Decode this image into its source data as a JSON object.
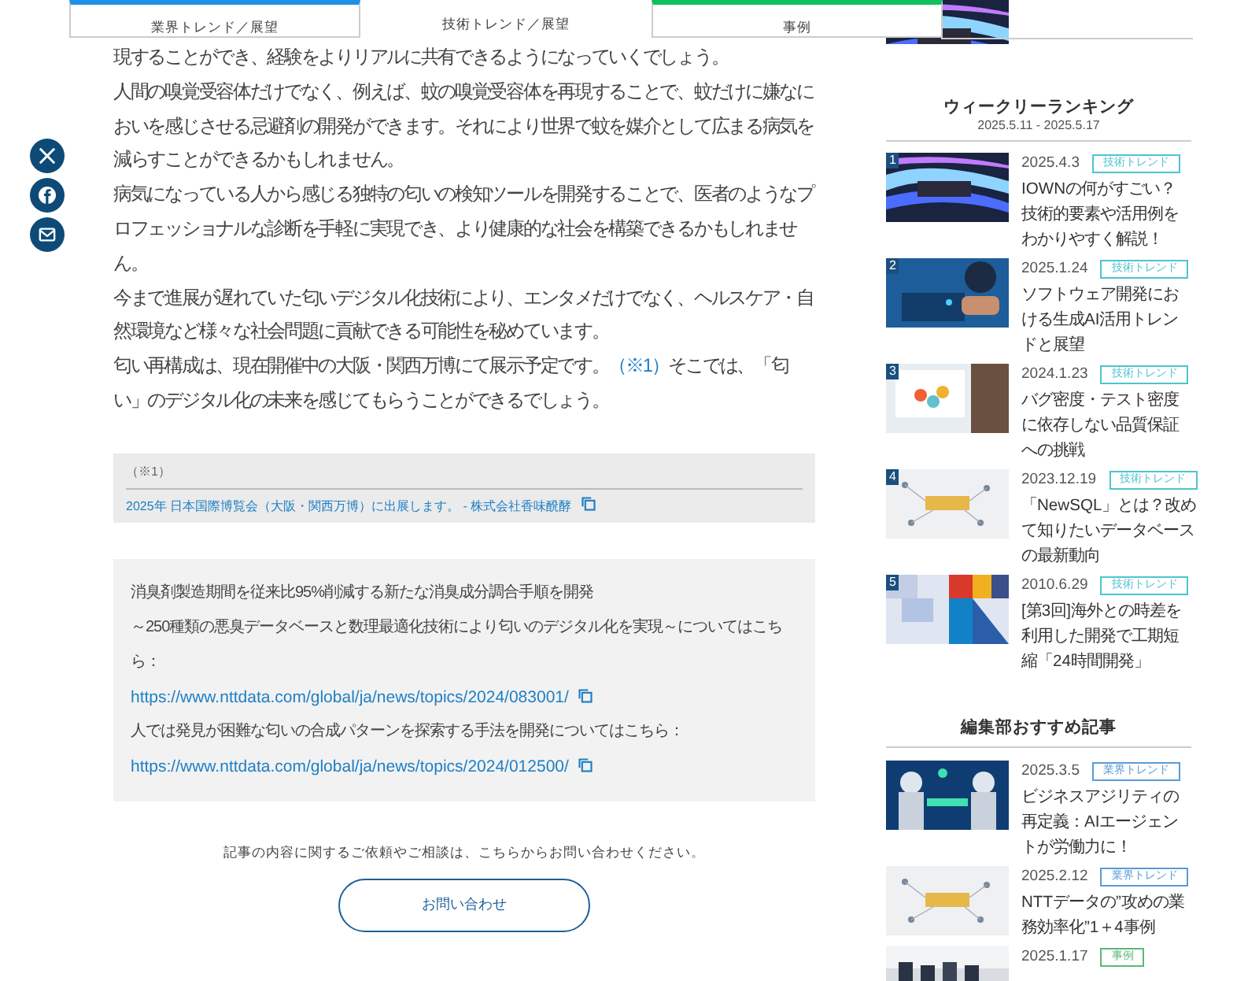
{
  "tabs": [
    {
      "label": "業界トレンド／展望",
      "selected": false,
      "color": "#1e90e6"
    },
    {
      "label": "技術トレンド／展望",
      "selected": true
    },
    {
      "label": "事例",
      "selected": false,
      "color": "#10c060"
    }
  ],
  "share": [
    {
      "kind": "x"
    },
    {
      "kind": "facebook"
    },
    {
      "kind": "mail"
    }
  ],
  "article": {
    "paragraphs": [
      "現することができ、経験をよりリアルに共有できるようになっていくでしょう。",
      "人間の嗅覚受容体だけでなく、例えば、蚊の嗅覚受容体を再現することで、蚊だけに嫌なにおいを感じさせる忌避剤の開発ができます。それにより世界で蚊を媒介として広まる病気を減らすことができるかもしれません。",
      "病気になっている人から感じる独特の匂いの検知ツールを開発することで、医者のようなプロフェッショナルな診断を手軽に実現でき、より健康的な社会を構築できるかもしれません。",
      "今まで進展が遅れていた匂いデジタル化技術により、エンタメだけでなく、ヘルスケア・自然環境など様々な社会問題に貢献できる可能性を秘めています。"
    ],
    "last_paragraph": {
      "before": "匂い再構成は、現在開催中の大阪・関西万博にて展示予定です。",
      "note_link": "（※1）",
      "after": "そこでは、「匂い」のデジタル化の未来を感じてもらうことができるでしょう。"
    }
  },
  "footnote": {
    "mark": "（※1）",
    "link": "2025年 日本国際博覧会（大阪・関西万博）に出展します。 - 株式会社香味醗酵"
  },
  "related": [
    {
      "kind": "text",
      "text": "消臭剤製造期間を従来比95%削減する新たな消臭成分調合手順を開発"
    },
    {
      "kind": "text",
      "text": "～250種類の悪臭データベースと数理最適化技術により匂いのデジタル化を実現～についてはこちら："
    },
    {
      "kind": "link",
      "text": "https://www.nttdata.com/global/ja/news/topics/2024/083001/"
    },
    {
      "kind": "text",
      "text": "人では発見が困難な匂いの合成パターンを探索する手法を開発についてはこちら："
    },
    {
      "kind": "link",
      "text": "https://www.nttdata.com/global/ja/news/topics/2024/012500/"
    }
  ],
  "contact": {
    "text": "記事の内容に関するご依頼やご相談は、こちらからお問い合わせください。",
    "button": "お問い合わせ"
  },
  "ranking": {
    "title": "ウィークリーランキング",
    "period": "2025.5.11 - 2025.5.17",
    "items": [
      {
        "rank": "1",
        "date": "2025.4.3",
        "tag": "技術トレンド",
        "color": "#4fc3d0",
        "title": "IOWNの何がすごい？技術的要素や活用例をわかりやすく解説！"
      },
      {
        "rank": "2",
        "date": "2025.1.24",
        "tag": "技術トレンド",
        "color": "#4fc3d0",
        "title": "ソフトウェア開発における生成AI活用トレンドと展望"
      },
      {
        "rank": "3",
        "date": "2024.1.23",
        "tag": "技術トレンド",
        "color": "#4fc3d0",
        "title": "バグ密度・テスト密度に依存しない品質保証への挑戦"
      },
      {
        "rank": "4",
        "date": "2023.12.19",
        "tag": "技術トレンド",
        "color": "#4fc3d0",
        "title": "「NewSQL」とは？改めて知りたいデータベースの最新動向"
      },
      {
        "rank": "5",
        "date": "2010.6.29",
        "tag": "技術トレンド",
        "color": "#4fc3d0",
        "title": "[第3回]海外との時差を利用した開発で工期短縮「24時間開発」"
      }
    ]
  },
  "recommended": {
    "title": "編集部おすすめ記事",
    "items": [
      {
        "date": "2025.3.5",
        "tag": "業界トレンド",
        "color": "#5b9bd5",
        "title": "ビジネスアジリティの再定義：AIエージェントが労働力に！"
      },
      {
        "date": "2025.2.12",
        "tag": "業界トレンド",
        "color": "#5b9bd5",
        "title": "NTTデータの”攻めの業務効率化”1＋4事例"
      },
      {
        "date": "2025.1.17",
        "tag": "事例",
        "color": "#5cb87a"
      }
    ]
  }
}
